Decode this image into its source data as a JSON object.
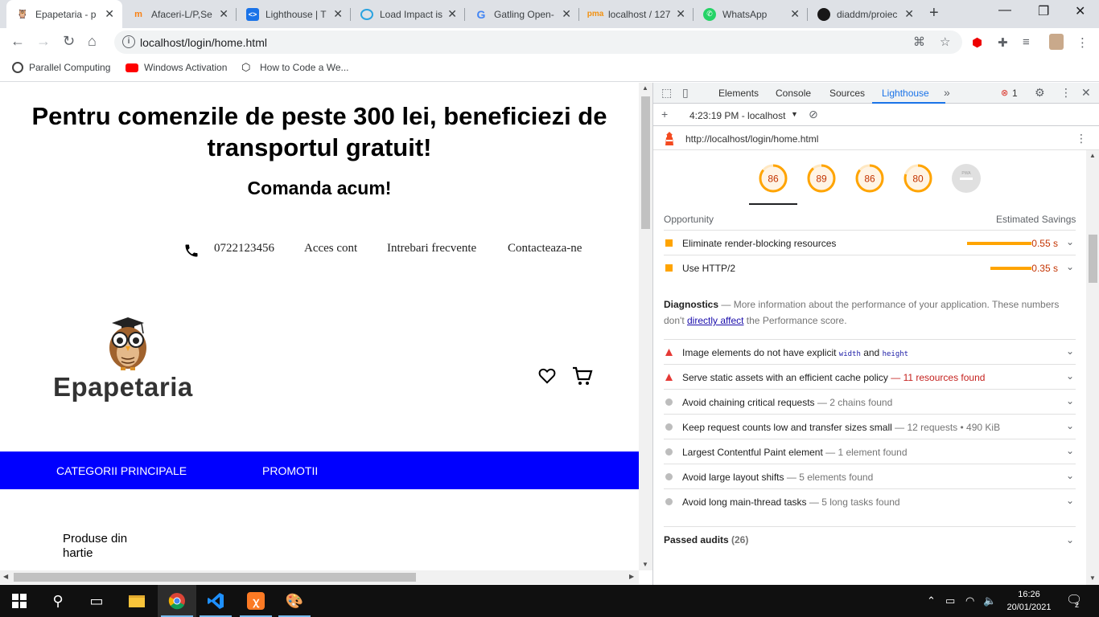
{
  "browser": {
    "tabs": [
      {
        "title": "Epapetaria - p",
        "favicon": "owl-icon",
        "active": true,
        "fav_color": "#8b5a2b"
      },
      {
        "title": "Afaceri-L/P,Se",
        "favicon": "moodle-icon",
        "active": false,
        "fav_color": "#f98012"
      },
      {
        "title": "Lighthouse | T",
        "favicon": "web-dev-icon",
        "active": false,
        "fav_color": "#1a73e8"
      },
      {
        "title": "Load Impact is",
        "favicon": "loadimpact-icon",
        "active": false,
        "fav_color": "#2aa3e0"
      },
      {
        "title": "Gatling Open-",
        "favicon": "google-icon",
        "active": false,
        "fav_color": "#4285f4"
      },
      {
        "title": "localhost / 127",
        "favicon": "phpmyadmin-icon",
        "active": false,
        "fav_color": "#f29111"
      },
      {
        "title": "WhatsApp",
        "favicon": "whatsapp-icon",
        "active": false,
        "fav_color": "#25d366"
      },
      {
        "title": "diaddm/proiec",
        "favicon": "github-icon",
        "active": false,
        "fav_color": "#181717"
      }
    ],
    "url": "localhost/login/home.html",
    "bookmarks": [
      {
        "label": "Parallel Computing",
        "icon": "parallel-icon"
      },
      {
        "label": "Windows Activation",
        "icon": "youtube-icon"
      },
      {
        "label": "How to Code a We...",
        "icon": "codepen-icon"
      }
    ]
  },
  "site": {
    "headline": "Pentru comenzile de peste 300 lei, beneficiezi de transportul gratuit!",
    "cta": "Comanda acum!",
    "phone": "0722123456",
    "nav": [
      "Acces cont",
      "Intrebari frecvente",
      "Contacteaza-ne"
    ],
    "brand": "Epapetaria",
    "menu": [
      "CATEGORII PRINCIPALE",
      "PROMOTII"
    ],
    "category": "Produse din hartie",
    "accent": "#0000ff"
  },
  "devtools": {
    "tabs": [
      "Elements",
      "Console",
      "Sources",
      "Lighthouse"
    ],
    "active_tab": "Lighthouse",
    "error_count": "1",
    "report_label": "4:23:19 PM - localhost",
    "report_url": "http://localhost/login/home.html",
    "scores": [
      {
        "value": 86,
        "label": "86"
      },
      {
        "value": 89,
        "label": "89"
      },
      {
        "value": 86,
        "label": "86"
      },
      {
        "value": 80,
        "label": "80"
      }
    ],
    "pwa_label": "PWA",
    "opportunity_header": "Opportunity",
    "savings_header": "Estimated Savings",
    "opportunities": [
      {
        "label": "Eliminate render-blocking resources",
        "value": "0.55 s",
        "fraction": 0.55
      },
      {
        "label": "Use HTTP/2",
        "value": "0.35 s",
        "fraction": 0.35
      }
    ],
    "diagnostics_title": "Diagnostics",
    "diagnostics_desc_1": "— More information about the performance of your application. These numbers don't ",
    "diagnostics_link": "directly affect",
    "diagnostics_desc_2": " the Performance score.",
    "diag_image": {
      "pre": "Image elements do not have explicit ",
      "code1": "width",
      "mid": " and ",
      "code2": "height"
    },
    "diagnostics": [
      {
        "label": "Serve static assets with an efficient cache policy",
        "extra": "— 11 resources found",
        "level": "fail"
      },
      {
        "label": "Avoid chaining critical requests",
        "extra": "— 2 chains found",
        "level": "info"
      },
      {
        "label": "Keep request counts low and transfer sizes small",
        "extra": "— 12 requests • 490 KiB",
        "level": "info"
      },
      {
        "label": "Largest Contentful Paint element",
        "extra": "— 1 element found",
        "level": "info"
      },
      {
        "label": "Avoid large layout shifts",
        "extra": "— 5 elements found",
        "level": "info"
      },
      {
        "label": "Avoid long main-thread tasks",
        "extra": "— 5 long tasks found",
        "level": "info"
      }
    ],
    "passed_label": "Passed audits",
    "passed_count": "(26)",
    "orange": "#ffa400",
    "red": "#c5221f"
  },
  "taskbar": {
    "time": "16:26",
    "date": "20/01/2021",
    "notifications": "2",
    "apps": [
      "start-icon",
      "search-icon",
      "task-view-icon",
      "file-explorer-icon",
      "chrome-icon",
      "vscode-icon",
      "xampp-icon",
      "paint-icon"
    ]
  }
}
